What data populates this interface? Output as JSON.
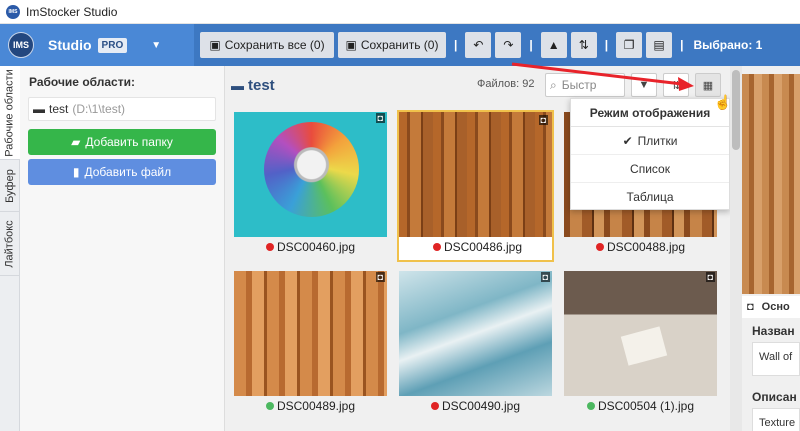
{
  "window": {
    "title": "ImStocker Studio"
  },
  "brand": {
    "logo_text": "IMS",
    "name": "Studio",
    "badge": "PRO"
  },
  "toolbar": {
    "save_all_label": "Сохранить все (0)",
    "save_label": "Сохранить (0)",
    "selected_label": "Выбрано: 1"
  },
  "vertical_tabs": [
    "Рабочие области",
    "Буфер",
    "Лайтбокс"
  ],
  "sidebar": {
    "heading": "Рабочие области:",
    "workspace": {
      "name": "test",
      "path": "(D:\\1\\test)"
    },
    "add_folder_label": "Добавить папку",
    "add_file_label": "Добавить файл"
  },
  "main": {
    "folder_name": "test",
    "files_count": "Файлов: 92",
    "search_placeholder": "Быстр"
  },
  "tiles": [
    {
      "filename": "DSC00460.jpg",
      "status_color": "#e02424",
      "selected": false
    },
    {
      "filename": "DSC00486.jpg",
      "status_color": "#e02424",
      "selected": true
    },
    {
      "filename": "DSC00488.jpg",
      "status_color": "#e02424",
      "selected": false
    },
    {
      "filename": "DSC00489.jpg",
      "status_color": "#4cb860",
      "selected": false
    },
    {
      "filename": "DSC00490.jpg",
      "status_color": "#e02424",
      "selected": false
    },
    {
      "filename": "DSC00504 (1).jpg",
      "status_color": "#4cb860",
      "selected": false
    }
  ],
  "view_menu": {
    "title": "Режим отображения",
    "options": [
      "Плитки",
      "Список",
      "Таблица"
    ],
    "checked": "Плитки"
  },
  "details": {
    "tab_label": "Осно",
    "title_label": "Назван",
    "title_value": "Wall of",
    "description_label": "Описан",
    "description_value": "Texture"
  },
  "colors": {
    "accent": "#3d78c2",
    "green_button": "#35b64a",
    "blue_button": "#5f8ee0",
    "selection": "#f0c14b"
  }
}
